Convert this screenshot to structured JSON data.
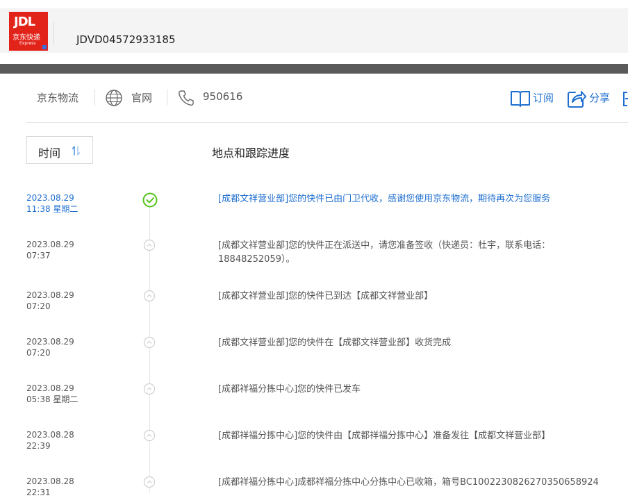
{
  "header": {
    "logo": {
      "jdl": "JDL",
      "cn": "京东快递",
      "en": "Express"
    },
    "tracking_number": "JDVD04572933185"
  },
  "carrier": {
    "name": "京东物流",
    "website_label": "官网",
    "phone": "950616"
  },
  "actions": {
    "subscribe_label": "订阅",
    "share_label": "分享"
  },
  "list": {
    "sort_label": "时间",
    "sort_icon": "sort-arrows-icon",
    "column_title": "地点和跟踪进度"
  },
  "events": [
    {
      "date": "2023.08.29",
      "time": "11:38 星期二",
      "desc": "[成都文祥营业部]您的快件已由门卫代收，感谢您使用京东物流，期待再次为您服务",
      "status": "delivered"
    },
    {
      "date": "2023.08.29",
      "time": "07:37",
      "desc": "[成都文祥营业部]您的快件正在派送中，请您准备签收（快递员：杜宇，联系电话：18848252059）。",
      "status": "normal"
    },
    {
      "date": "2023.08.29",
      "time": "07:20",
      "desc": "[成都文祥营业部]您的快件已到达【成都文祥营业部】",
      "status": "normal"
    },
    {
      "date": "2023.08.29",
      "time": "07:20",
      "desc": "[成都文祥营业部]您的快件在【成都文祥营业部】收货完成",
      "status": "normal"
    },
    {
      "date": "2023.08.29",
      "time": "05:38 星期二",
      "desc": "[成都祥福分拣中心]您的快件已发车",
      "status": "normal"
    },
    {
      "date": "2023.08.28",
      "time": "22:39",
      "desc": "[成都祥福分拣中心]您的快件由【成都祥福分拣中心】准备发往【成都文祥营业部】",
      "status": "normal"
    },
    {
      "date": "2023.08.28",
      "time": "22:31",
      "desc": "[成都祥福分拣中心]成都祥福分拣中心分拣中心已收箱，箱号BC1002230826270350658924",
      "status": "normal"
    }
  ],
  "colors": {
    "accent": "#1f6fd0",
    "success": "#52c41a",
    "brand": "#e2231a"
  }
}
